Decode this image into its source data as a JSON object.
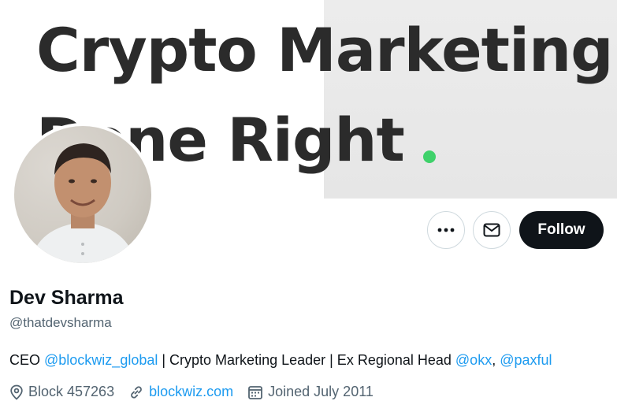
{
  "banner": {
    "line1": "Crypto Marketing",
    "line2": "Done Right",
    "dot_color": "#3fd16a"
  },
  "avatar": {
    "alt": "Dev Sharma profile photo"
  },
  "actions": {
    "more_icon": "more-icon",
    "mail_icon": "mail-icon",
    "follow_label": "Follow"
  },
  "profile": {
    "name": "Dev Sharma",
    "handle": "@thatdevsharma"
  },
  "bio": {
    "prefix": "CEO ",
    "mention1": "@blockwiz_global",
    "middle": " | Crypto Marketing Leader | Ex Regional Head ",
    "mention2": "@okx",
    "sep": ", ",
    "mention3": "@paxful"
  },
  "meta": {
    "location": "Block 457263",
    "website": "blockwiz.com",
    "joined": "Joined July 2011"
  },
  "colors": {
    "link": "#1d9bf0",
    "secondary_text": "#536471",
    "follow_bg": "#0f1419"
  }
}
